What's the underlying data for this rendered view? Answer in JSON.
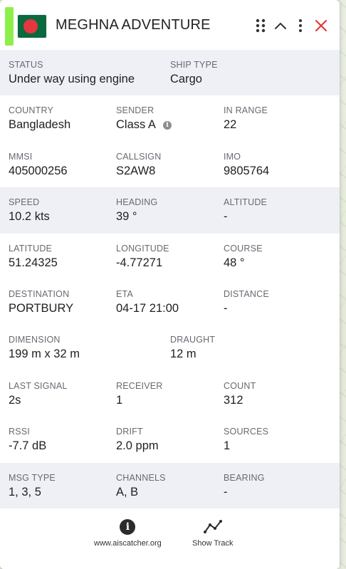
{
  "header": {
    "title": "MEGHNA ADVENTURE",
    "flag_icon": "bangladesh-flag-icon",
    "status_bar_color": "#8df04a",
    "close_color": "#e0352b"
  },
  "rows": [
    {
      "shade": true,
      "cells": [
        {
          "label": "STATUS",
          "value": "Under way using engine"
        },
        {
          "label": "SHIP TYPE",
          "value": "Cargo"
        }
      ]
    },
    {
      "shade": false,
      "cells": [
        {
          "label": "COUNTRY",
          "value": "Bangladesh"
        },
        {
          "label": "SENDER",
          "value": "Class A"
        },
        {
          "label": "IN RANGE",
          "value": "22"
        }
      ]
    },
    {
      "shade": false,
      "cells": [
        {
          "label": "MMSI",
          "value": "405000256"
        },
        {
          "label": "CALLSIGN",
          "value": "S2AW8"
        },
        {
          "label": "IMO",
          "value": "9805764"
        }
      ]
    },
    {
      "shade": true,
      "cells": [
        {
          "label": "SPEED",
          "value": "10.2 kts"
        },
        {
          "label": "HEADING",
          "value": "39 °"
        },
        {
          "label": "ALTITUDE",
          "value": "-"
        }
      ]
    },
    {
      "shade": false,
      "cells": [
        {
          "label": "LATITUDE",
          "value": "51.24325"
        },
        {
          "label": "LONGITUDE",
          "value": "-4.77271"
        },
        {
          "label": "COURSE",
          "value": "48 °"
        }
      ]
    },
    {
      "shade": false,
      "cells": [
        {
          "label": "DESTINATION",
          "value": "PORTBURY"
        },
        {
          "label": "ETA",
          "value": "04-17 21:00"
        },
        {
          "label": "DISTANCE",
          "value": "-"
        }
      ]
    },
    {
      "shade": false,
      "cells": [
        {
          "label": "DIMENSION",
          "value": "199 m x 32 m"
        },
        {
          "label": "DRAUGHT",
          "value": "12 m"
        }
      ]
    },
    {
      "shade": false,
      "cells": [
        {
          "label": "LAST SIGNAL",
          "value": "2s"
        },
        {
          "label": "RECEIVER",
          "value": "1"
        },
        {
          "label": "COUNT",
          "value": "312"
        }
      ]
    },
    {
      "shade": false,
      "cells": [
        {
          "label": "RSSI",
          "value": "-7.7 dB"
        },
        {
          "label": "DRIFT",
          "value": "2.0 ppm"
        },
        {
          "label": "SOURCES",
          "value": "1"
        }
      ]
    },
    {
      "shade": true,
      "cells": [
        {
          "label": "MSG TYPE",
          "value": "1, 3, 5"
        },
        {
          "label": "CHANNELS",
          "value": "A, B"
        },
        {
          "label": "BEARING",
          "value": "-"
        }
      ]
    }
  ],
  "footer": {
    "website_label": "www.aiscatcher.org",
    "track_label": "Show Track"
  }
}
